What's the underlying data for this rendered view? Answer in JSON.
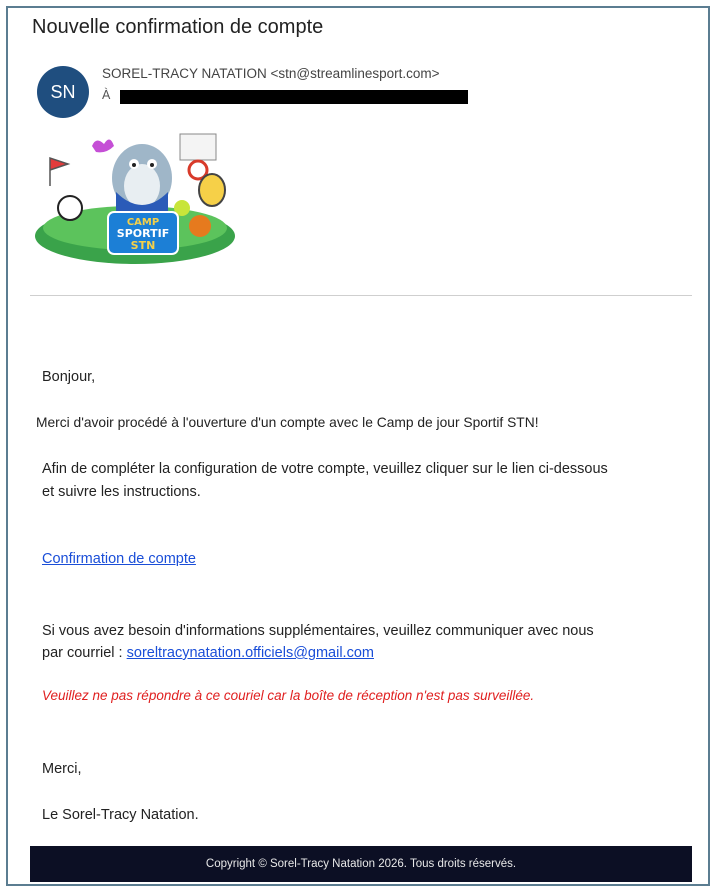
{
  "email": {
    "subject": "Nouvelle confirmation de compte",
    "avatar_initials": "SN",
    "sender": "SOREL-TRACY NATATION <stn@streamlinesport.com>",
    "to_label": "À",
    "logo_text": [
      "CAMP",
      "SPORTIF",
      "STN"
    ]
  },
  "body": {
    "greeting": "Bonjour,",
    "thanks_line": "Merci d'avoir procédé à l'ouverture d'un compte avec le Camp de jour Sportif STN!",
    "instructions_1": "Afin de compléter la configuration de votre compte, veuillez cliquer sur le lien ci-dessous",
    "instructions_2": "et suivre les instructions.",
    "confirm_link": "Confirmation de compte",
    "info_1": "Si vous avez besoin d'informations supplémentaires, veuillez communiquer avec nous",
    "info_2_prefix": "par courriel : ",
    "info_email": "soreltracynatation.officiels@gmail.com",
    "warning": "Veuillez ne pas répondre à ce couriel car la boîte de réception n'est pas surveillée.",
    "sign_1": "Merci,",
    "sign_2": "Le Sorel-Tracy Natation."
  },
  "footer": {
    "copyright": "Copyright © Sorel-Tracy Natation 2026. Tous droits réservés."
  },
  "colors": {
    "avatar": "#1f4e7f",
    "link": "#1a4ed8",
    "warning": "#e02020",
    "footer_bg": "#0c0f24"
  }
}
